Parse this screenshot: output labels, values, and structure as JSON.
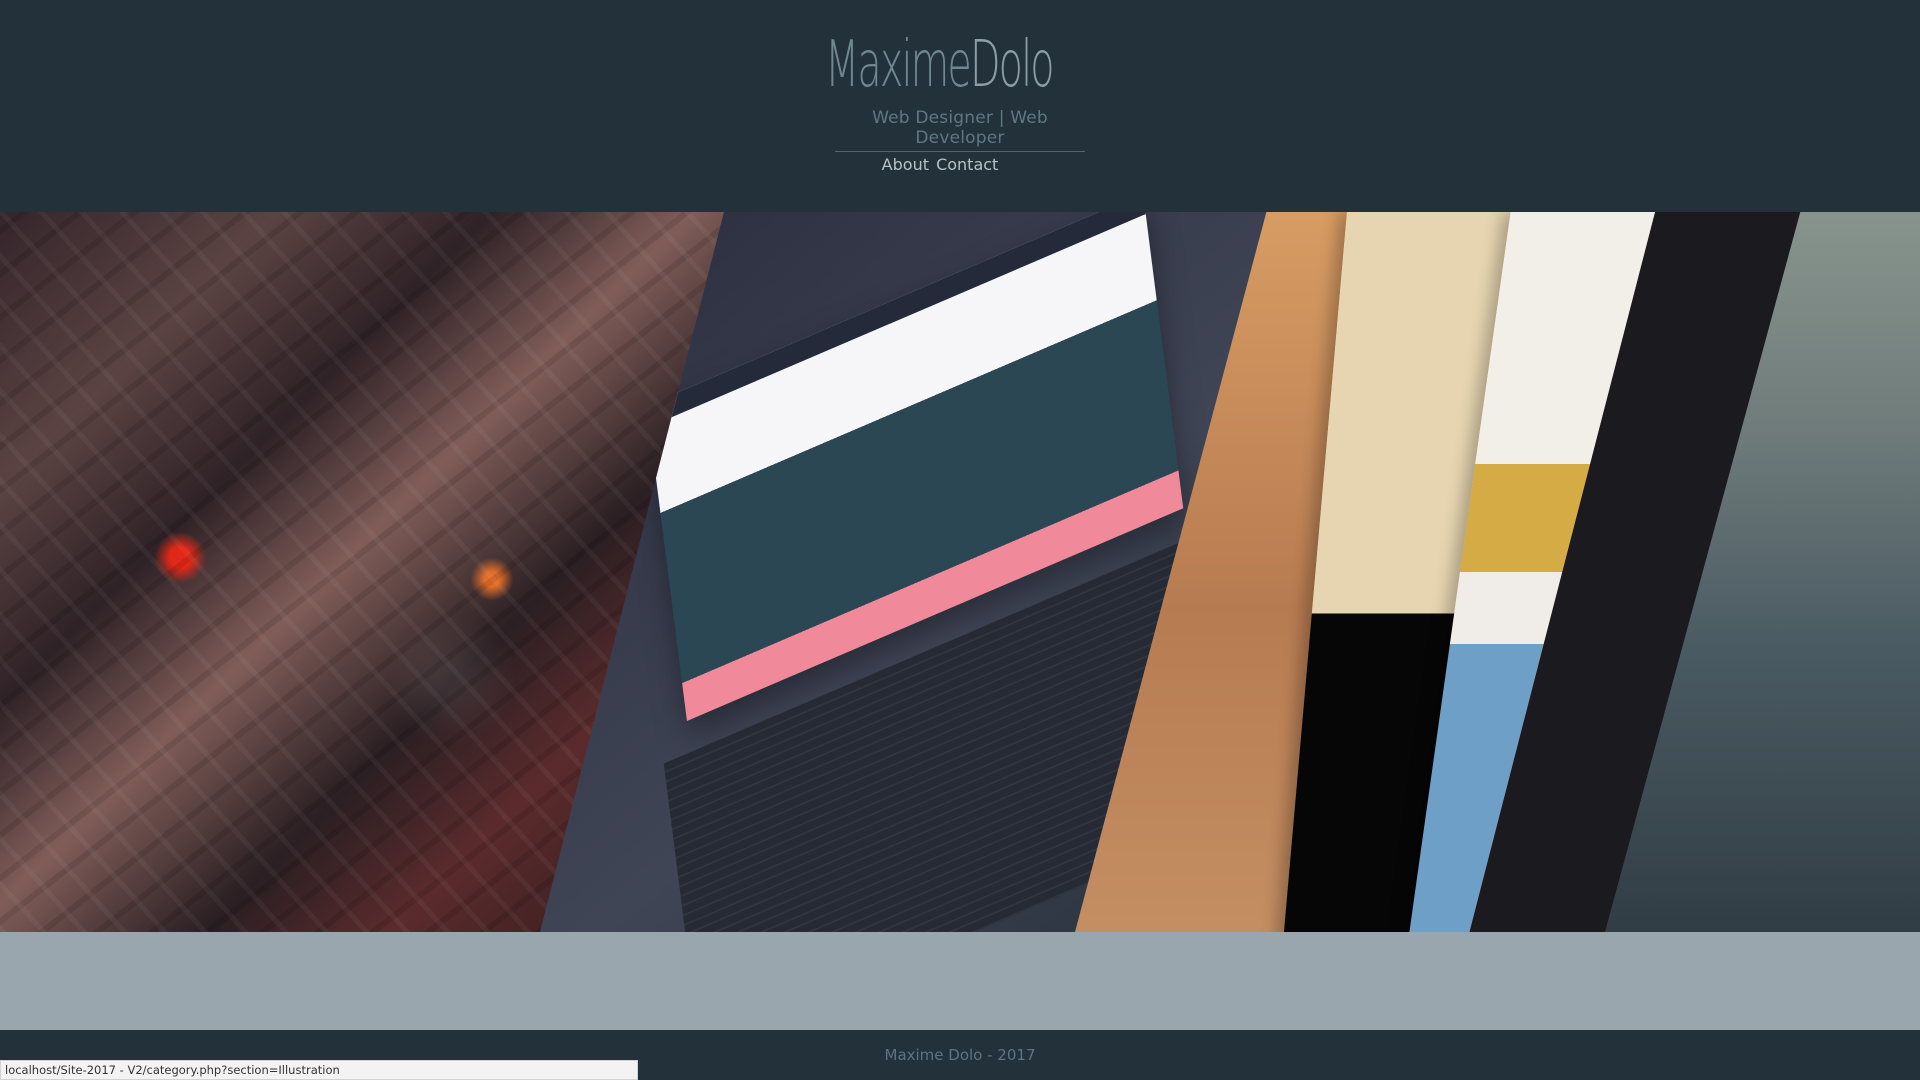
{
  "brand": {
    "name_prefix": "Maxime",
    "name_suffix": "Dolo",
    "subtitle": "Web Designer | Web Developer"
  },
  "nav": {
    "about": "About",
    "contact": "Contact"
  },
  "gallery": {
    "panels": [
      {
        "name": "illustration"
      },
      {
        "name": "web-design"
      },
      {
        "name": "print-books"
      },
      {
        "name": "photography"
      }
    ]
  },
  "footer": {
    "text": "Maxime Dolo - 2017"
  },
  "status_bar": {
    "url": "localhost/Site-2017 - V2/category.php?section=Illustration"
  },
  "colors": {
    "header_bg": "#22313a",
    "band_bg": "#9aa6ae",
    "text": "#607880"
  }
}
